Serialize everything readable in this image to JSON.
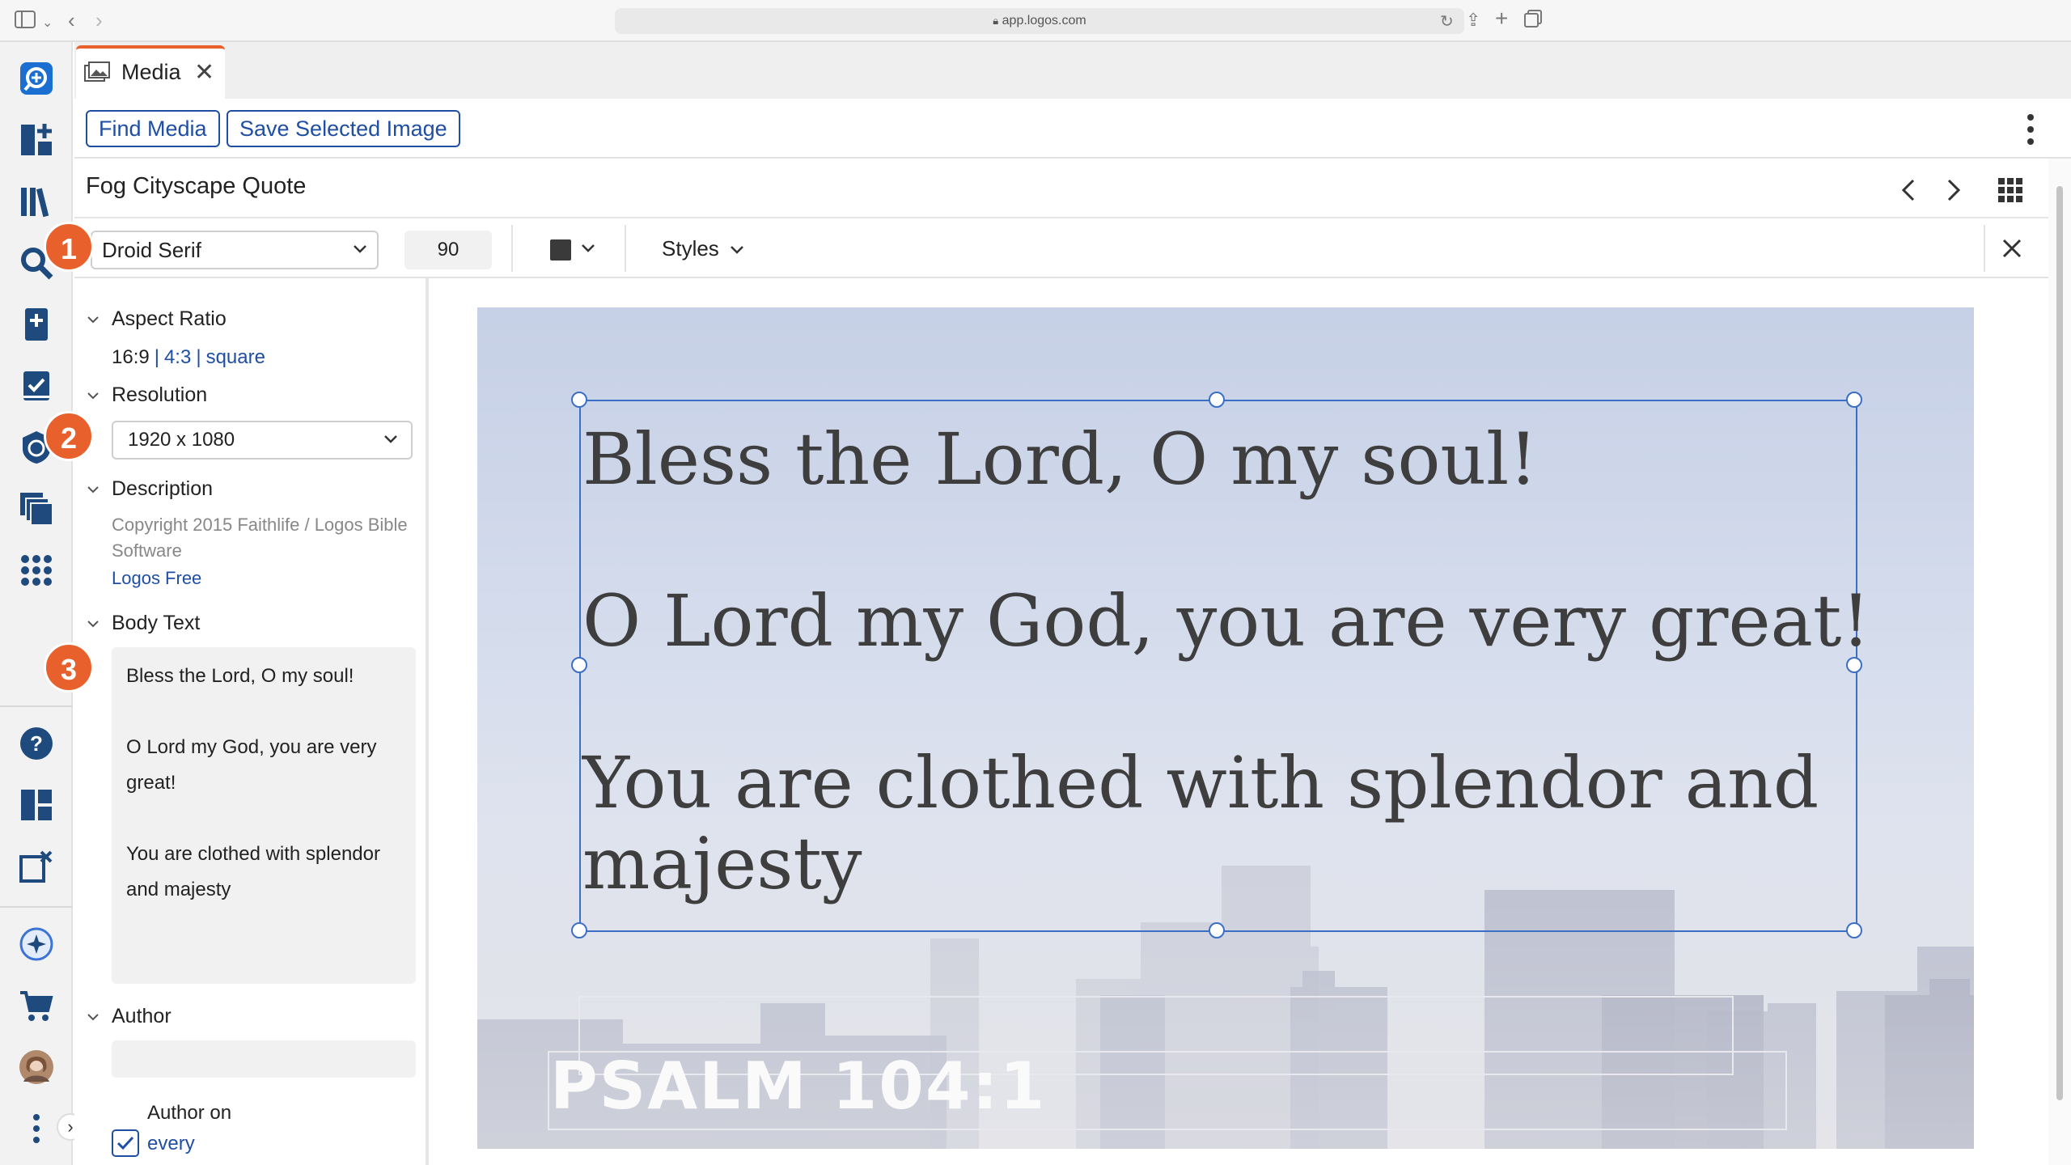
{
  "browser": {
    "url": "app.logos.com"
  },
  "rail": {
    "icons": [
      "logos-home-icon",
      "dashboard-add-icon",
      "library-icon",
      "search-icon",
      "bible-add-icon",
      "checklist-icon",
      "leaf-badge-icon",
      "layers-icon",
      "apps-grid-icon",
      "help-icon",
      "layout-icon",
      "close-panels-icon",
      "ai-sparkle-icon",
      "cart-icon",
      "user-avatar",
      "more-icon",
      "expand-chevron-icon"
    ]
  },
  "tab": {
    "label": "Media",
    "close": "✕"
  },
  "toolbar": {
    "find_media": "Find Media",
    "save_image": "Save Selected Image"
  },
  "title": "Fog Cityscape Quote",
  "format": {
    "font": "Droid Serif",
    "size": "90",
    "styles": "Styles",
    "text_color": "#3a3a3a"
  },
  "panel": {
    "aspect_ratio": {
      "heading": "Aspect Ratio",
      "options": [
        "16:9",
        "4:3",
        "square"
      ]
    },
    "resolution": {
      "heading": "Resolution",
      "value": "1920 x 1080"
    },
    "description": {
      "heading": "Description",
      "line1": "Copyright 2015 Faithlife / Logos Bible",
      "line2": "Software",
      "link": "Logos Free"
    },
    "body_text": {
      "heading": "Body Text",
      "lines": [
        "Bless the Lord, O my soul!",
        "",
        "O Lord my God, you are very",
        "great!",
        "",
        "You are clothed with splendor",
        "and majesty"
      ]
    },
    "author": {
      "heading": "Author",
      "value": "",
      "author_on": "Author on",
      "every": "every"
    }
  },
  "badges": [
    "1",
    "2",
    "3"
  ],
  "preview": {
    "lines": [
      "Bless the Lord, O my soul!",
      "O Lord my God, you are very great!",
      "You are clothed with splendor and",
      "majesty"
    ],
    "reference": "PSALM 104:1"
  },
  "colors": {
    "accent": "#1f4ea3",
    "badge": "#e8612c",
    "rail_icon": "#1e4a7d"
  }
}
